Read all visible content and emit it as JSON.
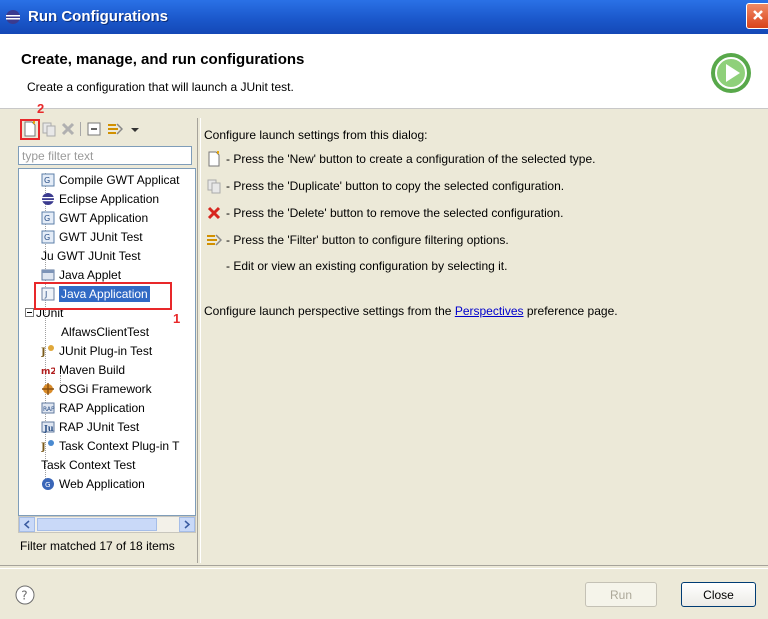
{
  "window": {
    "title": "Run Configurations"
  },
  "header": {
    "title": "Create, manage, and run configurations",
    "description": "Create a configuration that will launch a JUnit test."
  },
  "left": {
    "toolbar": {
      "new": "new-configuration-icon",
      "duplicate": "duplicate-icon",
      "delete": "delete-icon",
      "collapse": "collapse-all-icon",
      "filter": "filter-icon",
      "menu": "view-menu-icon"
    },
    "filter_placeholder": "type filter text",
    "tree": [
      {
        "label": "Compile GWT Applicat",
        "icon": "gwt-compile-icon"
      },
      {
        "label": "Eclipse Application",
        "icon": "eclipse-icon"
      },
      {
        "label": "GWT Application",
        "icon": "gwt-icon"
      },
      {
        "label": "GWT JUnit Test",
        "icon": "gwt-junit-icon"
      },
      {
        "label": "Ju GWT JUnit Test",
        "icon": "junit-icon"
      },
      {
        "label": "Java Applet",
        "icon": "applet-icon"
      },
      {
        "label": "Java Application",
        "icon": "java-app-icon",
        "selected": true
      },
      {
        "label": "JUnit",
        "icon": "junit-icon",
        "expanded": true
      },
      {
        "label": "AlfawsClientTest",
        "icon": "junit-icon",
        "child": true
      },
      {
        "label": "JUnit Plug-in Test",
        "icon": "junit-plugin-icon"
      },
      {
        "label": "Maven Build",
        "icon": "maven-icon"
      },
      {
        "label": "OSGi Framework",
        "icon": "osgi-icon"
      },
      {
        "label": "RAP Application",
        "icon": "rap-icon"
      },
      {
        "label": "RAP JUnit Test",
        "icon": "rap-junit-icon"
      },
      {
        "label": "Task Context Plug-in T",
        "icon": "task-plugin-icon"
      },
      {
        "label": "Task Context Test",
        "icon": "task-test-icon"
      },
      {
        "label": "Web Application",
        "icon": "web-app-icon"
      }
    ],
    "filter_status": "Filter matched 17 of 18 items"
  },
  "right": {
    "intro": "Configure launch settings from this dialog:",
    "bullets": [
      {
        "icon": "new-configuration-icon",
        "text": "- Press the 'New' button to create a configuration of the selected type."
      },
      {
        "icon": "duplicate-icon",
        "text": "- Press the 'Duplicate' button to copy the selected configuration."
      },
      {
        "icon": "delete-icon",
        "text": "- Press the 'Delete' button to remove the selected configuration."
      },
      {
        "icon": "filter-icon",
        "text": "- Press the 'Filter' button to configure filtering options."
      },
      {
        "icon": "",
        "text": "- Edit or view an existing configuration by selecting it."
      }
    ],
    "perspective_pre": "Configure launch perspective settings from the ",
    "perspective_link": "Perspectives",
    "perspective_post": " preference page."
  },
  "buttons": {
    "run": "Run",
    "close": "Close"
  },
  "annotations": {
    "first": "1",
    "second": "2"
  },
  "colors": {
    "selection": "#316ac5",
    "annotation": "#e8282a",
    "titlebar": "#1a56c9"
  }
}
